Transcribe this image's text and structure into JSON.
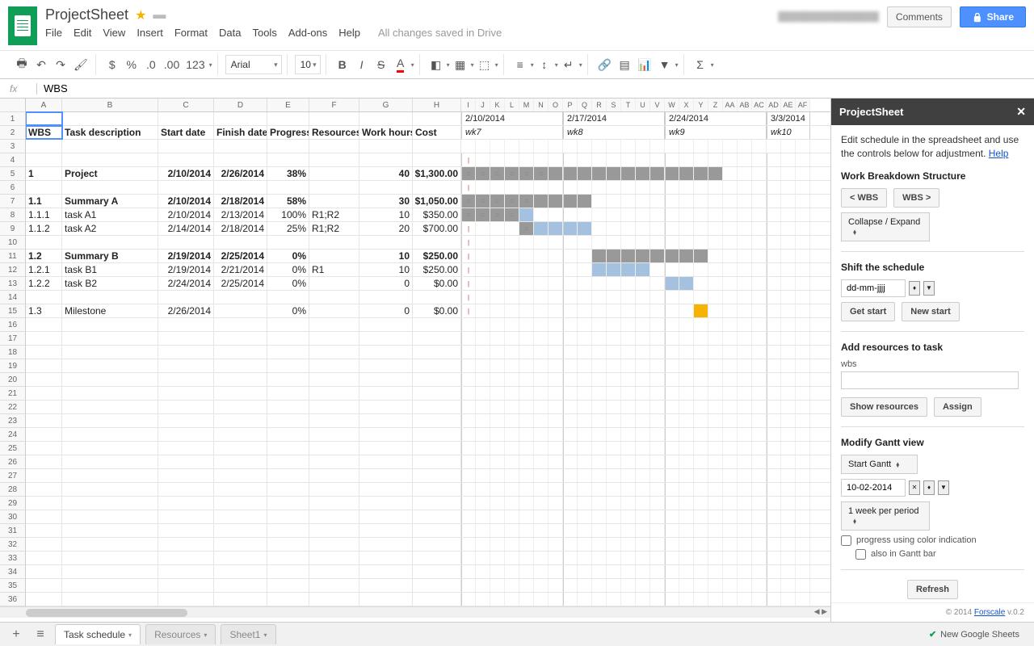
{
  "doc": {
    "title": "ProjectSheet",
    "drive_status": "All changes saved in Drive"
  },
  "menus": [
    "File",
    "Edit",
    "View",
    "Insert",
    "Format",
    "Data",
    "Tools",
    "Add-ons",
    "Help"
  ],
  "header_buttons": {
    "comments": "Comments",
    "share": "Share"
  },
  "toolbar": {
    "font": "Arial",
    "size": "10",
    "format_menu": "123"
  },
  "formula_bar": {
    "value": "WBS"
  },
  "columns_main": [
    "A",
    "B",
    "C",
    "D",
    "E",
    "F",
    "G",
    "H"
  ],
  "columns_gantt_letters": [
    "I",
    "J",
    "K",
    "L",
    "M",
    "N",
    "O",
    "P",
    "Q",
    "R",
    "S",
    "T",
    "U",
    "V",
    "W",
    "X",
    "Y",
    "Z",
    "AA",
    "AB",
    "AC",
    "AD",
    "AE",
    "AF"
  ],
  "headers": {
    "A": "WBS",
    "B": "Task description",
    "C": "Start date",
    "D": "Finish date",
    "E": "Progress",
    "F": "Resources",
    "G": "Work hours",
    "H": "Cost"
  },
  "weeks": [
    {
      "date": "2/10/2014",
      "label": "wk7"
    },
    {
      "date": "2/17/2014",
      "label": "wk8"
    },
    {
      "date": "2/24/2014",
      "label": "wk9"
    },
    {
      "date": "3/3/2014",
      "label": "wk10"
    }
  ],
  "rows": [
    {
      "n": 4,
      "wbs": "",
      "task": "",
      "start": "",
      "finish": "",
      "prog": "",
      "res": "",
      "hours": "",
      "cost": "",
      "bold": false,
      "gantt": {
        "0": "tick"
      }
    },
    {
      "n": 5,
      "wbs": "1",
      "task": "Project",
      "start": "2/10/2014",
      "finish": "2/26/2014",
      "prog": "38%",
      "res": "",
      "hours": "40",
      "cost": "$1,300.00",
      "bold": true,
      "gantt": {
        "0": "eq",
        "1": "eq",
        "2": "eq",
        "3": "eq",
        "4": "eq",
        "5": "eq",
        "6": "gray",
        "7": "gray",
        "8": "gray",
        "9": "gray",
        "10": "gray",
        "11": "gray",
        "12": "gray",
        "13": "gray",
        "14": "gray",
        "15": "gray",
        "16": "gray",
        "17": "gray"
      }
    },
    {
      "n": 6,
      "wbs": "",
      "task": "",
      "start": "",
      "finish": "",
      "prog": "",
      "res": "",
      "hours": "",
      "cost": "",
      "bold": false,
      "gantt": {
        "0": "tick"
      }
    },
    {
      "n": 7,
      "wbs": "1.1",
      "task": "Summary A",
      "start": "2/10/2014",
      "finish": "2/18/2014",
      "prog": "58%",
      "res": "",
      "hours": "30",
      "cost": "$1,050.00",
      "bold": true,
      "gantt": {
        "0": "eq",
        "1": "eq",
        "2": "eq",
        "3": "eq",
        "4": "eq",
        "5": "gray",
        "6": "gray",
        "7": "gray",
        "8": "gray"
      }
    },
    {
      "n": 8,
      "wbs": "1.1.1",
      "task": "task A1",
      "start": "2/10/2014",
      "finish": "2/13/2014",
      "prog": "100%",
      "res": "R1;R2",
      "hours": "10",
      "cost": "$350.00",
      "bold": false,
      "gantt": {
        "0": "eq",
        "1": "eq",
        "2": "eq",
        "3": "eq",
        "4": "blue"
      }
    },
    {
      "n": 9,
      "wbs": "1.1.2",
      "task": "task A2",
      "start": "2/14/2014",
      "finish": "2/18/2014",
      "prog": "25%",
      "res": "R1;R2",
      "hours": "20",
      "cost": "$700.00",
      "bold": false,
      "gantt": {
        "0": "tick",
        "4": "eq",
        "5": "blue",
        "6": "blue",
        "7": "blue",
        "8": "blue"
      }
    },
    {
      "n": 10,
      "wbs": "",
      "task": "",
      "start": "",
      "finish": "",
      "prog": "",
      "res": "",
      "hours": "",
      "cost": "",
      "bold": false,
      "gantt": {
        "0": "tick"
      }
    },
    {
      "n": 11,
      "wbs": "1.2",
      "task": "Summary B",
      "start": "2/19/2014",
      "finish": "2/25/2014",
      "prog": "0%",
      "res": "",
      "hours": "10",
      "cost": "$250.00",
      "bold": true,
      "gantt": {
        "0": "tick",
        "9": "gray",
        "10": "gray",
        "11": "gray",
        "12": "gray",
        "13": "gray",
        "14": "gray",
        "15": "gray",
        "16": "gray"
      }
    },
    {
      "n": 12,
      "wbs": "1.2.1",
      "task": "task B1",
      "start": "2/19/2014",
      "finish": "2/21/2014",
      "prog": "0%",
      "res": "R1",
      "hours": "10",
      "cost": "$250.00",
      "bold": false,
      "gantt": {
        "0": "tick",
        "9": "blue",
        "10": "blue",
        "11": "blue",
        "12": "blue"
      }
    },
    {
      "n": 13,
      "wbs": "1.2.2",
      "task": "task B2",
      "start": "2/24/2014",
      "finish": "2/25/2014",
      "prog": "0%",
      "res": "",
      "hours": "0",
      "cost": "$0.00",
      "bold": false,
      "gantt": {
        "0": "tick",
        "14": "blue",
        "15": "blue"
      }
    },
    {
      "n": 14,
      "wbs": "",
      "task": "",
      "start": "",
      "finish": "",
      "prog": "",
      "res": "",
      "hours": "",
      "cost": "",
      "bold": false,
      "gantt": {
        "0": "tick"
      }
    },
    {
      "n": 15,
      "wbs": "1.3",
      "task": "Milestone",
      "start": "2/26/2014",
      "finish": "",
      "prog": "0%",
      "res": "",
      "hours": "0",
      "cost": "$0.00",
      "bold": false,
      "gantt": {
        "0": "tick",
        "16": "orange"
      }
    }
  ],
  "empty_rows_start": 16,
  "empty_rows_end": 36,
  "sidebar": {
    "title": "ProjectSheet",
    "desc": "Edit schedule in the spreadsheet and use the controls below for adjustment. ",
    "help": "Help",
    "wbs_title": "Work Breakdown Structure",
    "wbs_prev": "<  WBS",
    "wbs_next": "WBS  >",
    "collapse": "Collapse / Expand",
    "shift_title": "Shift the schedule",
    "shift_format": "dd-mm-jjjj",
    "get_start": "Get start",
    "new_start": "New start",
    "add_res_title": "Add resources to task",
    "wbs_label": "wbs",
    "show_res": "Show resources",
    "assign": "Assign",
    "gantt_title": "Modify Gantt view",
    "start_gantt": "Start Gantt",
    "gantt_date": "10-02-2014",
    "period": "1 week per period",
    "check1": "progress using color indication",
    "check2": "also in Gantt bar",
    "refresh": "Refresh",
    "footer_copyright": "© 2014 ",
    "footer_link": "Forscale",
    "footer_ver": " v.0.2"
  },
  "tabs": {
    "active": "Task schedule",
    "others": [
      "Resources",
      "Sheet1"
    ],
    "new_sheets": "New Google Sheets"
  }
}
